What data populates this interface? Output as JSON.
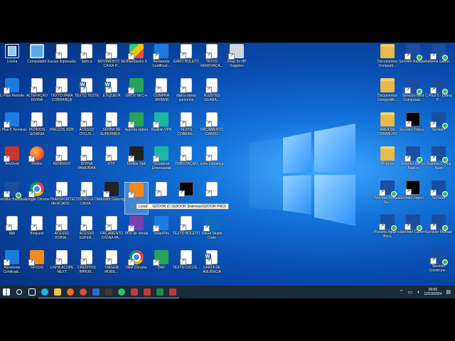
{
  "desktop_icons_left": [
    {
      "label": "Lixeira",
      "glyph": "recycle-bin-icon",
      "kind": "recycle"
    },
    {
      "label": "Computador",
      "glyph": "computer-icon",
      "kind": "pc"
    },
    {
      "label": "Excluir impressão",
      "glyph": "document-icon",
      "kind": "file"
    },
    {
      "label": "fabrica",
      "glyph": "document-icon",
      "kind": "file"
    },
    {
      "label": "MOVIMENTO DE CAIXA P...",
      "glyph": "document-icon",
      "kind": "file"
    },
    {
      "label": "BlueStacks X",
      "glyph": "bluestacks-icon",
      "kind": "multi"
    },
    {
      "label": "Assistente Certificad...",
      "glyph": "assistant-icon",
      "kind": "blue"
    },
    {
      "label": "ERRO BOLETO",
      "glyph": "document-icon",
      "kind": "file"
    },
    {
      "label": "TEXTO RENOVAÇA...",
      "glyph": "document-icon",
      "kind": "file"
    },
    {
      "label": "Shop for HP Supplies",
      "glyph": "printer-icon",
      "kind": "gray"
    },
    {
      "label": "C-Plus Remote",
      "glyph": "cplus-icon",
      "kind": "blue"
    },
    {
      "label": "ALTERAÇÃO DIVINA",
      "glyph": "document-icon",
      "kind": "file"
    },
    {
      "label": "TEXTO PARA COBRANÇA",
      "glyph": "document-icon",
      "kind": "file"
    },
    {
      "label": "TEXTO TESTE",
      "glyph": "word-document-icon",
      "kind": "word"
    },
    {
      "label": "ETIQUETA",
      "glyph": "word-document-icon",
      "kind": "word"
    },
    {
      "label": "GPDV NFC-e",
      "glyph": "gdoor-icon",
      "kind": "green"
    },
    {
      "label": "COMPRA JAYARM",
      "glyph": "document-icon",
      "kind": "file"
    },
    {
      "label": "dados divina pamonha",
      "glyph": "document-icon",
      "kind": "file"
    },
    {
      "label": "AJUSTES GUARA...",
      "glyph": "document-icon",
      "kind": "file"
    },
    {
      "label": "C-Plus 5 Terminal",
      "glyph": "cplus-icon",
      "kind": "blue"
    },
    {
      "label": "PEDIDOS GOIANIA",
      "glyph": "document-icon",
      "kind": "file"
    },
    {
      "label": "PREÇOS 2025",
      "glyph": "document-icon",
      "kind": "file"
    },
    {
      "label": "ACESSO CPLUS...",
      "glyph": "document-icon",
      "kind": "file"
    },
    {
      "label": "SENHA DE SUPERMER...",
      "glyph": "document-icon",
      "kind": "file"
    },
    {
      "label": "Agenda Gdoor",
      "glyph": "clock-icon",
      "kind": "green"
    },
    {
      "label": "Radmin VPN",
      "glyph": "radmin-icon",
      "kind": "teal"
    },
    {
      "label": "TEXTO COBRAN...",
      "glyph": "document-icon",
      "kind": "file"
    },
    {
      "label": "ORÇAMENTO CARRO",
      "glyph": "document-icon",
      "kind": "file"
    },
    {
      "label": "AnyDesk",
      "glyph": "anydesk-icon",
      "kind": "red"
    },
    {
      "label": "Firefox",
      "glyph": "firefox-icon",
      "kind": "firefox"
    },
    {
      "label": "KENRADO",
      "glyph": "document-icon",
      "kind": "file"
    },
    {
      "label": "DIVINA PAMONHA",
      "glyph": "document-icon",
      "kind": "file"
    },
    {
      "label": "FTP",
      "glyph": "document-icon",
      "kind": "file"
    },
    {
      "label": "Umbler Talk",
      "glyph": "umbler-icon",
      "kind": "dark"
    },
    {
      "label": "Sicoobnet Empresarial",
      "glyph": "sicoob-icon",
      "kind": "teal"
    },
    {
      "label": "TRIBUTAÇÃO",
      "glyph": "document-icon",
      "kind": "file"
    },
    {
      "label": "texto cobrança",
      "glyph": "document-icon",
      "kind": "file"
    },
    {
      "label": "Servidor Balsatao",
      "glyph": "server-icon",
      "kind": "darkblue"
    },
    {
      "label": "Google Chrome",
      "glyph": "chrome-icon",
      "kind": "chrome"
    },
    {
      "label": "TRANSPORTE MERCADO...",
      "glyph": "document-icon",
      "kind": "file"
    },
    {
      "label": "CONTROLE DE CAIXA...",
      "glyph": "document-icon",
      "kind": "file"
    },
    {
      "label": "Monitor Gdoorfg",
      "glyph": "gdoor-monitor-icon",
      "kind": "dark"
    },
    {
      "label": "",
      "glyph": "gdoor-icon",
      "kind": "orange"
    },
    {
      "label": "",
      "glyph": "document-icon",
      "kind": "file"
    },
    {
      "label": "",
      "glyph": "archive-icon",
      "kind": "black"
    },
    {
      "label": "",
      "glyph": "document-icon",
      "kind": "file"
    },
    {
      "label": "bbb",
      "glyph": "document-icon",
      "kind": "file"
    },
    {
      "label": "Bloqueio",
      "glyph": "document-icon",
      "kind": "file"
    },
    {
      "label": "ACESSO DIVINA...",
      "glyph": "document-icon",
      "kind": "file"
    },
    {
      "label": "ACESSO SUPER...",
      "glyph": "document-icon",
      "kind": "file"
    },
    {
      "label": "ORÇAMENTO DIVINA PA...",
      "glyph": "document-icon",
      "kind": "file"
    },
    {
      "label": "PDV de Venda",
      "glyph": "pdv-icon",
      "kind": "purple"
    },
    {
      "label": "SmartPdv",
      "glyph": "smartpdv-icon",
      "kind": "blue"
    },
    {
      "label": "TEXTO BOLETO",
      "glyph": "document-icon",
      "kind": "file"
    },
    {
      "label": "Visual Studio Code",
      "glyph": "vscode-icon",
      "kind": "vscode"
    },
    {
      "label": "Assistente Certificad...",
      "glyph": "assistant-icon",
      "kind": "blue"
    },
    {
      "label": "GFOOD",
      "glyph": "gfood-icon",
      "kind": "orange"
    },
    {
      "label": "LINHA ACOPE NEXT",
      "glyph": "document-icon",
      "kind": "file"
    },
    {
      "label": "CREDITOS IMPERI...",
      "glyph": "document-icon",
      "kind": "file"
    },
    {
      "label": "VIAGEM MOBIL...",
      "glyph": "document-icon",
      "kind": "file"
    },
    {
      "label": "Next Chrome",
      "glyph": "chrome-icon",
      "kind": "chrome"
    },
    {
      "label": "DAV",
      "glyph": "dav-icon",
      "kind": "green"
    },
    {
      "label": "TEXTO CICLIS...",
      "glyph": "document-icon",
      "kind": "file"
    },
    {
      "label": "CARTA DE ANUÊNCIA",
      "glyph": "word-document-icon",
      "kind": "word"
    }
  ],
  "desktop_icons_right": [
    {
      "label": "Documentos Comparti...",
      "glyph": "folder-icon",
      "kind": "folder"
    },
    {
      "label": "Servidor Balsatao",
      "glyph": "server-icon",
      "kind": "darkblue"
    },
    {
      "label": "Sistema Gdoor...",
      "glyph": "server-icon",
      "kind": "darkblue"
    },
    {
      "label": "Documentos Compartilh...",
      "glyph": "folder-icon",
      "kind": "folder"
    },
    {
      "label": "Servidor Next Computad...",
      "glyph": "server-icon",
      "kind": "darkblue"
    },
    {
      "label": "C-Plus 5 - Divina P...",
      "glyph": "server-icon",
      "kind": "darkblue"
    },
    {
      "label": "ÁREA DE TRABALHO",
      "glyph": "folder-icon",
      "kind": "folder"
    },
    {
      "label": "Servidor Divina...",
      "glyph": "server-icon",
      "kind": "black"
    },
    {
      "label": "Servidor",
      "glyph": "server-icon",
      "kind": "darkblue"
    },
    {
      "label": "Pictures",
      "glyph": "folder-icon",
      "kind": "folder"
    },
    {
      "label": "Servidor Rei do Básico",
      "glyph": "server-icon",
      "kind": "darkblue"
    },
    {
      "label": "Sistema C-Plus Next",
      "glyph": "server-icon",
      "kind": "darkblue"
    },
    {
      "label": "Servidor Pontual Su...",
      "glyph": "server-icon",
      "kind": "darkblue"
    },
    {
      "label": "Servidor Imperi...",
      "glyph": "server-icon",
      "kind": "black"
    },
    {
      "label": "Servidor",
      "glyph": "server-icon",
      "kind": "darkblue"
    },
    {
      "label": "Pizzaria Água na Boca",
      "glyph": "server-icon",
      "kind": "darkblue"
    },
    {
      "label": "Servidor Carrem",
      "glyph": "server-icon",
      "kind": "darkblue"
    },
    {
      "label": "Servidor Manual",
      "glyph": "server-icon",
      "kind": "darkblue"
    },
    {
      "label": "",
      "glyph": "",
      "kind": ""
    },
    {
      "label": "",
      "glyph": "",
      "kind": ""
    },
    {
      "label": "Servidor Construne...",
      "glyph": "server-icon",
      "kind": "darkblue"
    }
  ],
  "tooltip": {
    "label": "Local:",
    "path": "GDOOR (C:\\GDOOR Sistemas\\GDOOR PRO)"
  },
  "taskbar": {
    "items": [
      "start-icon",
      "search-icon",
      "task-view-icon",
      "edge-icon",
      "file-explorer-icon",
      "firefox-icon",
      "chrome-icon",
      "outlook-icon",
      "calculator-icon",
      "whatsapp-icon",
      "app-icon",
      "app-icon",
      "excel-icon",
      "app-icon"
    ],
    "tray": {
      "time": "09:56",
      "date": "12/10/2024"
    }
  }
}
